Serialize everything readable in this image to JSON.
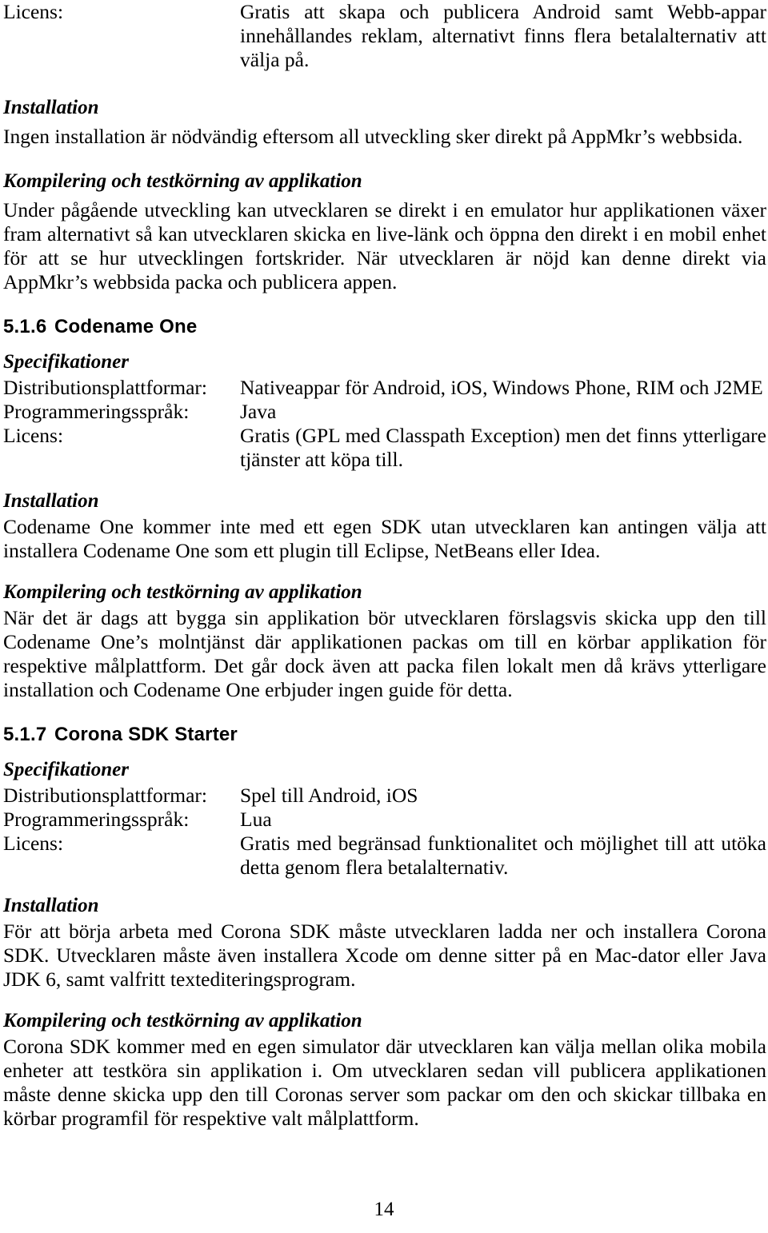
{
  "document": {
    "page_number": "14",
    "language": "sv"
  },
  "top_spec": {
    "license_label": "Licens:",
    "license_value": "Gratis att skapa och publicera Android samt Webb-appar innehållandes reklam, alternativt finns flera betalalternativ att välja på."
  },
  "appmkr": {
    "installation_heading": "Installation",
    "installation_text": "Ingen installation är nödvändig eftersom all utveckling sker direkt på AppMkr’s webbsida.",
    "compile_heading": "Kompilering och testkörning av applikation",
    "compile_text": "Under pågående utveckling kan utvecklaren se direkt i en emulator hur applikationen växer fram alternativt så kan utvecklaren skicka en live-länk och öppna den direkt i en mobil enhet för att se hur utvecklingen fortskrider. När utvecklaren är nöjd kan denne direkt via AppMkr’s webbsida packa och publicera appen."
  },
  "codename_one": {
    "section_number": "5.1.6",
    "section_title": "Codename One",
    "spec_heading": "Specifikationer",
    "specs": [
      {
        "label": "Distributionsplattformar:",
        "value": "Nativeappar för Android, iOS, Windows Phone, RIM och J2ME"
      },
      {
        "label": "Programmeringsspråk:",
        "value": "Java"
      },
      {
        "label": "Licens:",
        "value": "Gratis (GPL med Classpath Exception) men det finns ytterligare tjänster att köpa till."
      }
    ],
    "installation_heading": "Installation",
    "installation_text": "Codename One kommer inte med ett egen SDK utan utvecklaren kan antingen välja att installera Codename One som ett plugin till Eclipse, NetBeans eller Idea.",
    "compile_heading": "Kompilering och testkörning av applikation",
    "compile_text": "När det är dags att bygga sin applikation bör utvecklaren förslagsvis skicka upp den till Codename One’s molntjänst där applikationen packas om till en körbar applikation för respektive målplattform. Det går dock även att packa filen lokalt men då krävs ytterligare installation och Codename One erbjuder ingen guide för detta."
  },
  "corona_sdk": {
    "section_number": "5.1.7",
    "section_title": "Corona SDK Starter",
    "spec_heading": "Specifikationer",
    "specs": [
      {
        "label": "Distributionsplattformar:",
        "value": "Spel till Android, iOS"
      },
      {
        "label": "Programmeringsspråk:",
        "value": "Lua"
      },
      {
        "label": "Licens:",
        "value": "Gratis med begränsad funktionalitet och möjlighet till att utöka detta genom flera betalalternativ."
      }
    ],
    "installation_heading": "Installation",
    "installation_text": "För att börja arbeta med Corona SDK måste utvecklaren ladda ner och installera Corona SDK. Utvecklaren måste även installera Xcode om denne sitter på en Mac-dator eller Java JDK 6, samt valfritt textediteringsprogram.",
    "compile_heading": "Kompilering och testkörning av applikation",
    "compile_text": "Corona SDK kommer med en egen simulator där utvecklaren kan välja mellan olika mobila enheter att testköra sin applikation i. Om utvecklaren sedan vill publicera applikationen måste denne skicka upp den till Coronas server som packar om den och skickar tillbaka en körbar programfil för respektive valt målplattform."
  }
}
